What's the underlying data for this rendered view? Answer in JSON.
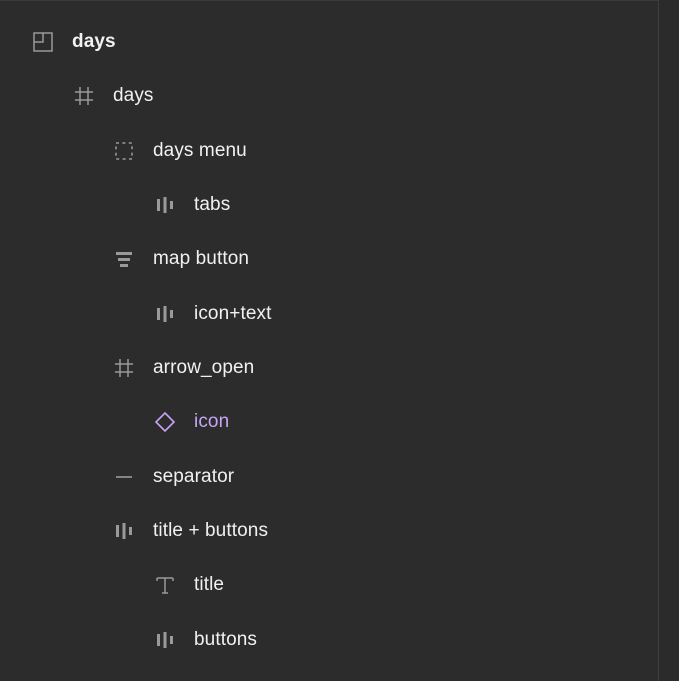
{
  "layers": [
    {
      "name": "days",
      "icon": "section-icon",
      "depth": 0,
      "bold": true
    },
    {
      "name": "days",
      "icon": "frame-icon",
      "depth": 1
    },
    {
      "name": "days menu",
      "icon": "group-dashed-icon",
      "depth": 2
    },
    {
      "name": "tabs",
      "icon": "autolayout-horizontal-icon",
      "depth": 3
    },
    {
      "name": "map button",
      "icon": "autolayout-vertical-icon",
      "depth": 2
    },
    {
      "name": "icon+text",
      "icon": "autolayout-horizontal-icon",
      "depth": 3
    },
    {
      "name": "arrow_open",
      "icon": "frame-icon",
      "depth": 2
    },
    {
      "name": "icon",
      "icon": "instance-diamond-icon",
      "depth": 3,
      "color": "#c7a4f6"
    },
    {
      "name": "separator",
      "icon": "line-icon",
      "depth": 2
    },
    {
      "name": "title + buttons",
      "icon": "autolayout-horizontal-icon",
      "depth": 2
    },
    {
      "name": "title",
      "icon": "text-icon",
      "depth": 3
    },
    {
      "name": "buttons",
      "icon": "autolayout-horizontal-icon",
      "depth": 3
    }
  ],
  "colors": {
    "background": "#2c2c2c",
    "text": "#f1f1f1",
    "icon": "#9a9a9a",
    "component_purple": "#c7a4f6"
  }
}
